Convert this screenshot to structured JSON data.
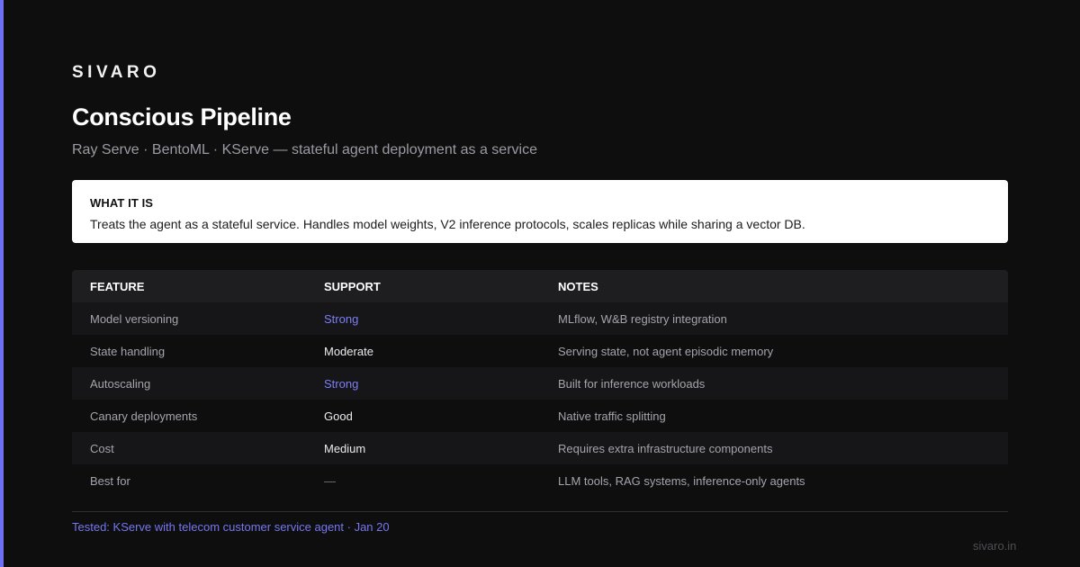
{
  "brand": "SIVARO",
  "title": "Conscious Pipeline",
  "subtitle": "Ray Serve · BentoML · KServe — stateful agent deployment as a service",
  "summary": {
    "label": "WHAT IT IS",
    "text": "Treats the agent as a stateful service. Handles model weights, V2 inference protocols, scales replicas while sharing a vector DB."
  },
  "table": {
    "headers": [
      "FEATURE",
      "SUPPORT",
      "NOTES"
    ],
    "rows": [
      {
        "feature": "Model versioning",
        "support": "Strong",
        "notes": "MLflow, W&B registry integration"
      },
      {
        "feature": "State handling",
        "support": "Moderate",
        "notes": "Serving state, not agent episodic memory"
      },
      {
        "feature": "Autoscaling",
        "support": "Strong",
        "notes": "Built for inference workloads"
      },
      {
        "feature": "Canary deployments",
        "support": "Good",
        "notes": "Native traffic splitting"
      },
      {
        "feature": "Cost",
        "support": "Medium",
        "notes": "Requires extra infrastructure components"
      },
      {
        "feature": "Best for",
        "support": "—",
        "notes": "LLM tools, RAG systems, inference-only agents"
      }
    ]
  },
  "footer": {
    "note": "Tested: KServe with telecom customer service agent · Jan 20",
    "site": "sivaro.in"
  },
  "colors": {
    "accent": "#6d6ff5",
    "strong": "#7c7ef7",
    "background": "#0e0e0f"
  }
}
